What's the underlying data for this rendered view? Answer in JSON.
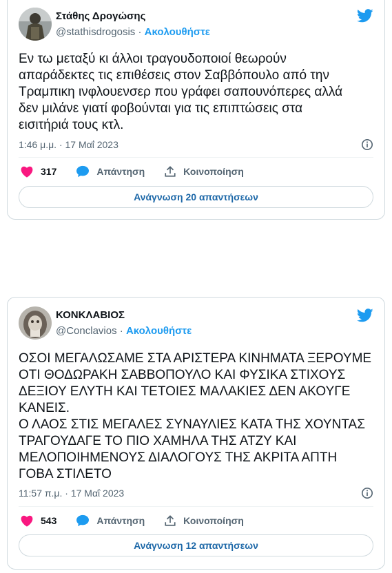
{
  "tweets": [
    {
      "name": "Στάθης Δρογώσης",
      "handle": "@stathisdrogosis",
      "separator": "·",
      "follow_label": "Ακολουθήστε",
      "text": "Εν τω μεταξύ κι άλλοι τραγουδοποιοί θεωρούν\nαπαράδεκτες τις επιθέσεις στον Σαββόπουλο από την\nΤραμπικη ινφλουενσερ που γράφει σαπουνόπερες αλλά\nδεν μιλάνε γιατί φοβούνται για τις επιπτώσεις στα\nεισιτήριά τους κτλ.",
      "timestamp": "1:46 μ.μ. · 17 Μαΐ 2023",
      "likes": "317",
      "reply_label": "Απάντηση",
      "share_label": "Κοινοποίηση",
      "read_replies_label": "Ανάγνωση 20 απαντήσεων"
    },
    {
      "name": "ΚΟΝΚΛΑΒΙΟΣ",
      "handle": "@Conclavios",
      "separator": "·",
      "follow_label": "Ακολουθήστε",
      "text": "ΟΣΟΙ ΜΕΓΑΛΩΣΑΜΕ ΣΤΑ ΑΡΙΣΤΕΡΑ ΚΙΝΗΜΑΤΑ ΞΕΡΟΥΜΕ\nΟΤΙ ΘΟΔΩΡΑΚΗ ΣΑΒΒΟΠΟΥΛΟ ΚΑΙ ΦΥΣΙΚΑ ΣΤΙΧΟΥΣ\nΔΕΞΙΟΥ ΕΛΥΤΗ ΚΑΙ ΤΕΤΟΙΕΣ ΜΑΛΑΚΙΕΣ ΔΕΝ ΑΚΟΥΓΕ\nΚΑΝΕΙΣ.\nΟ ΛΑΟΣ ΣΤΙΣ ΜΕΓΑΛΕΣ ΣΥΝΑΥΛΙΕΣ ΚΑΤΑ ΤΗΣ ΧΟΥΝΤΑΣ\nΤΡΑΓΟΥΔΑΓΕ ΤΟ ΠΙΟ ΧΑΜΗΛΑ ΤΗΣ ΑΤΖΥ ΚΑΙ\nΜΕΛΟΠΟΙΗΜΕΝΟΥΣ ΔΙΑΛΟΓΟΥΣ ΤΗΣ ΑΚΡΙΤΑ ΑΠΤΗ\nΓΟΒΑ ΣΤΙΛΕΤΟ",
      "timestamp": "11:57 π.μ. · 17 Μαΐ 2023",
      "likes": "543",
      "reply_label": "Απάντηση",
      "share_label": "Κοινοποίηση",
      "read_replies_label": "Ανάγνωση 12 απαντήσεων"
    }
  ],
  "colors": {
    "accent": "#1d9bf0",
    "like": "#f91880",
    "muted": "#536471",
    "border": "#cfd9de"
  },
  "icons": [
    "twitter-bird-icon",
    "info-icon",
    "heart-icon",
    "reply-icon",
    "share-icon"
  ]
}
